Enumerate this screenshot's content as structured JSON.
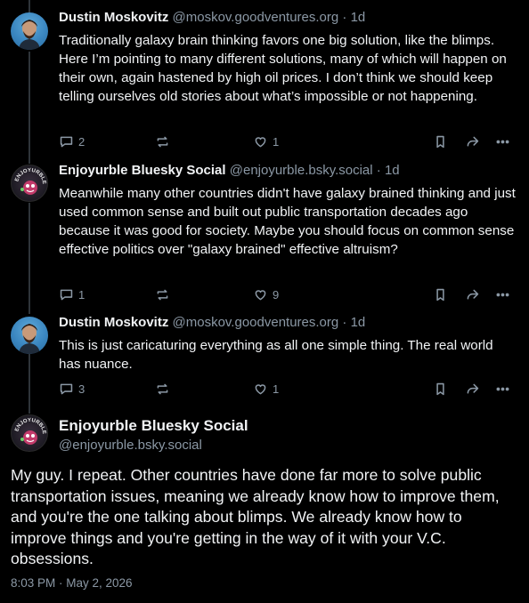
{
  "posts": [
    {
      "author": "Dustin Moskovitz",
      "handle": "@moskov.goodventures.org",
      "age": "1d",
      "text": "Traditionally galaxy brain thinking favors one big solution, like the blimps. Here I’m pointing to many different solutions, many of which will happen on their own, again hastened by high oil prices. I don’t think we should keep telling ourselves old stories about what’s impossible or not happening.",
      "replies": "2",
      "reposts": "",
      "likes": "1"
    },
    {
      "author": "Enjoyurble Bluesky Social",
      "handle": "@enjoyurble.bsky.social",
      "age": "1d",
      "text": "Meanwhile many other countries didn't have galaxy brained thinking and just used common sense and built out public transportation decades ago because it was good for society. Maybe you should focus on common sense effective politics over \"galaxy brained\" effective altruism?",
      "replies": "1",
      "reposts": "",
      "likes": "9"
    },
    {
      "author": "Dustin Moskovitz",
      "handle": "@moskov.goodventures.org",
      "age": "1d",
      "text": "This is just caricaturing everything as all one simple thing. The real world has nuance.",
      "replies": "3",
      "reposts": "",
      "likes": "1"
    }
  ],
  "separator": "·",
  "main_post": {
    "author": "Enjoyurble Bluesky Social",
    "handle": "@enjoyurble.bsky.social",
    "text": "My guy. I repeat. Other countries have done far more to solve public transportation issues, meaning we already know how to improve them, and you're the one talking about blimps. We already know how to improve things and you're getting in the way of it with your V.C. obsessions.",
    "timestamp": "8:03 PM · May 2, 2026"
  },
  "avatar_lettering": "ENJOYURBLE",
  "icons": {
    "reply": "reply-bubble-icon",
    "repost": "repost-arrows-icon",
    "like": "heart-icon",
    "bookmark": "bookmark-icon",
    "share": "share-arrow-icon",
    "more": "more-dots-icon"
  },
  "colors": {
    "background": "#000000",
    "text": "#f1f3f5",
    "muted": "#8b98a5",
    "thread_line": "#2e3439"
  }
}
